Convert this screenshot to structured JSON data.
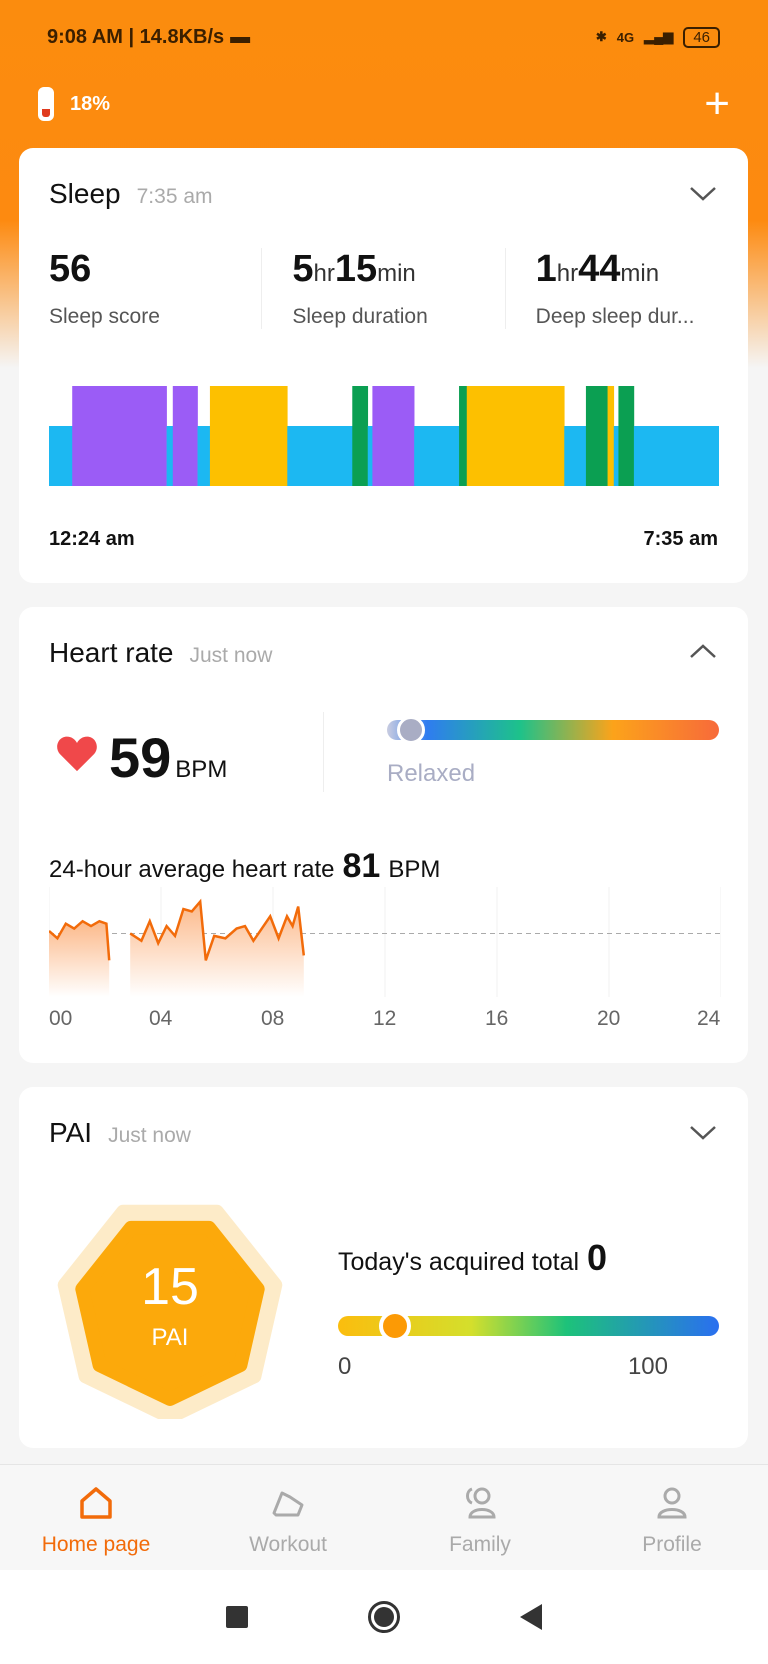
{
  "status_bar": {
    "time": "9:08 AM",
    "net_speed": "14.8KB/s",
    "battery": "46",
    "network": "4G"
  },
  "header": {
    "band_battery": "18%",
    "add_icon": "plus-icon"
  },
  "sleep": {
    "title": "Sleep",
    "time": "7:35 am",
    "stats": [
      {
        "value": "56",
        "label": "Sleep score"
      },
      {
        "v1": "5",
        "u1": "hr",
        "v2": "15",
        "u2": "min",
        "label": "Sleep duration"
      },
      {
        "v1": "1",
        "u1": "hr",
        "v2": "44",
        "u2": "min",
        "label": "Deep sleep dur..."
      }
    ],
    "start": "12:24 am",
    "end": "7:35 am",
    "colors": {
      "light": "#1cb8f2",
      "deep": "#9b5cf6",
      "rem": "#fdc000",
      "awake": "#0b9f52"
    },
    "segments_minutes": [
      [
        "light",
        15
      ],
      [
        "deep",
        61
      ],
      [
        "light",
        4
      ],
      [
        "deep",
        16
      ],
      [
        "light",
        8
      ],
      [
        "rem",
        50
      ],
      [
        "light",
        42
      ],
      [
        "awake",
        10
      ],
      [
        "light",
        3
      ],
      [
        "deep",
        27
      ],
      [
        "light",
        29
      ],
      [
        "awake",
        5
      ],
      [
        "rem",
        63
      ],
      [
        "light",
        14
      ],
      [
        "awake",
        14
      ],
      [
        "rem",
        4
      ],
      [
        "light",
        3
      ],
      [
        "awake",
        10
      ],
      [
        "light",
        55
      ]
    ]
  },
  "heart": {
    "title": "Heart rate",
    "time": "Just now",
    "value": "59",
    "unit": "BPM",
    "status": "Relaxed",
    "level": 0.06,
    "avg_label": "24-hour average heart rate",
    "avg": "81",
    "avg_unit": "BPM",
    "ticks": [
      "00",
      "04",
      "08",
      "12",
      "16",
      "20",
      "24"
    ],
    "series": [
      [
        [
          0,
          82
        ],
        [
          0.3,
          79
        ],
        [
          0.6,
          85
        ],
        [
          0.9,
          83
        ],
        [
          1.2,
          86
        ],
        [
          1.5,
          84
        ],
        [
          1.8,
          86
        ],
        [
          2.05,
          85
        ],
        [
          2.15,
          70
        ]
      ],
      [
        [
          2.9,
          81
        ],
        [
          3.3,
          78
        ],
        [
          3.6,
          86
        ],
        [
          3.9,
          77
        ],
        [
          4.2,
          84
        ],
        [
          4.5,
          80
        ],
        [
          4.8,
          91
        ],
        [
          5.1,
          90
        ],
        [
          5.4,
          94
        ],
        [
          5.6,
          70
        ],
        [
          5.9,
          80
        ],
        [
          6.3,
          79
        ],
        [
          6.7,
          83
        ],
        [
          7.0,
          84
        ],
        [
          7.3,
          78
        ],
        [
          7.6,
          83
        ],
        [
          7.9,
          88
        ],
        [
          8.2,
          79
        ],
        [
          8.5,
          88
        ],
        [
          8.7,
          84
        ],
        [
          8.9,
          92
        ],
        [
          9.1,
          72
        ]
      ]
    ],
    "y_range": [
      55,
      100
    ]
  },
  "pai": {
    "title": "PAI",
    "time": "Just now",
    "value": "15",
    "unit": "PAI",
    "today_label": "Today's acquired total",
    "today": "0",
    "min": "0",
    "max": "100",
    "level": 0.15
  },
  "nav": [
    {
      "label": "Home page",
      "icon": "home-icon"
    },
    {
      "label": "Workout",
      "icon": "shoe-icon"
    },
    {
      "label": "Family",
      "icon": "family-icon"
    },
    {
      "label": "Profile",
      "icon": "profile-icon"
    }
  ]
}
